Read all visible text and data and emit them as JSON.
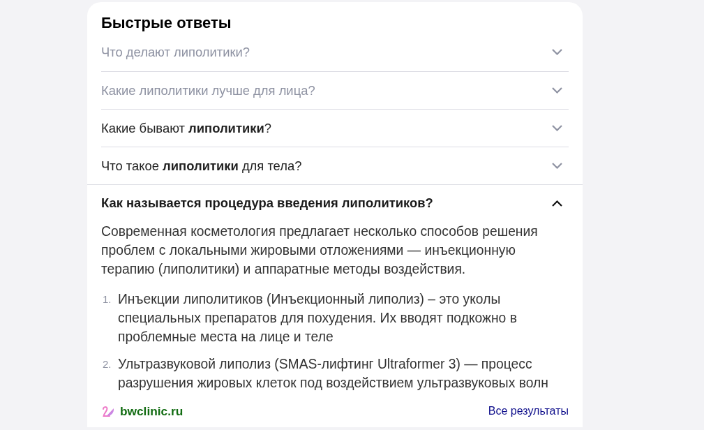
{
  "title": "Быстрые ответы",
  "questions": [
    {
      "text": "Что делают липолитики?",
      "visited": true,
      "expanded": false
    },
    {
      "text": "Какие липолитики лучше для лица?",
      "visited": true,
      "expanded": false
    },
    {
      "text": "Какие бывают **липолитики**?",
      "visited": false,
      "expanded": false
    },
    {
      "text": "Что такое **липолитики** для тела?",
      "visited": false,
      "expanded": false
    },
    {
      "text": "Как называется процедура введения липолитиков?",
      "visited": false,
      "expanded": true,
      "answer": {
        "paragraph": "Современная косметология предлагает несколько способов решения проблем с локальными жировыми отложениями — инъекционную терапию (липолитики) и аппаратные методы воздействия.",
        "list": [
          {
            "number": "1.",
            "text": "Инъекции липолитиков (Инъекционный липолиз) – это уколы специальных препаратов для похудения. Их вводят подкожно в проблемные места на лице и теле"
          },
          {
            "number": "2.",
            "text": "Ультразвуковой липолиз (SMAS-лифтинг Ultraformer 3) — процесс разрушения жировых клеток под воздействием ультразвуковых волн"
          }
        ]
      }
    }
  ],
  "footer": {
    "source": "bwclinic.ru",
    "all_results": "Все результаты"
  }
}
